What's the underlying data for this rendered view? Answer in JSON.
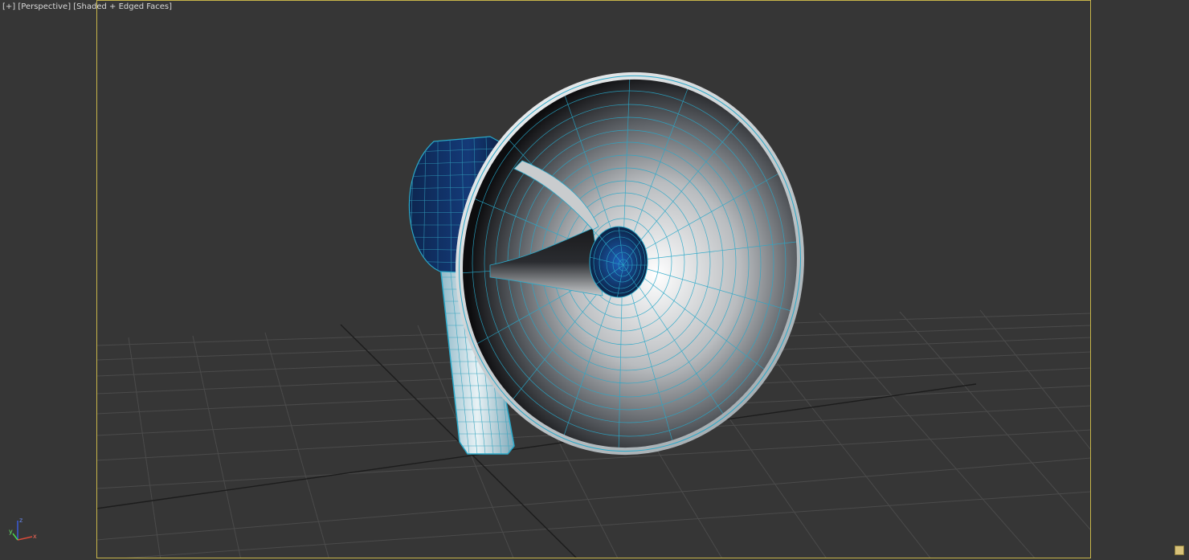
{
  "viewport": {
    "label_plus": "[+]",
    "label_view": "[Perspective]",
    "label_shading": "[Shaded + Edged Faces]"
  },
  "axis": {
    "x": "x",
    "y": "y",
    "z": "z"
  },
  "colors": {
    "background": "#363636",
    "grid": "#4a4a4a",
    "grid_axis": "#1a1a1a",
    "safe_frame": "#c8b64a",
    "wire": "#2aa8c8",
    "body_dark": "#0f2a55"
  }
}
